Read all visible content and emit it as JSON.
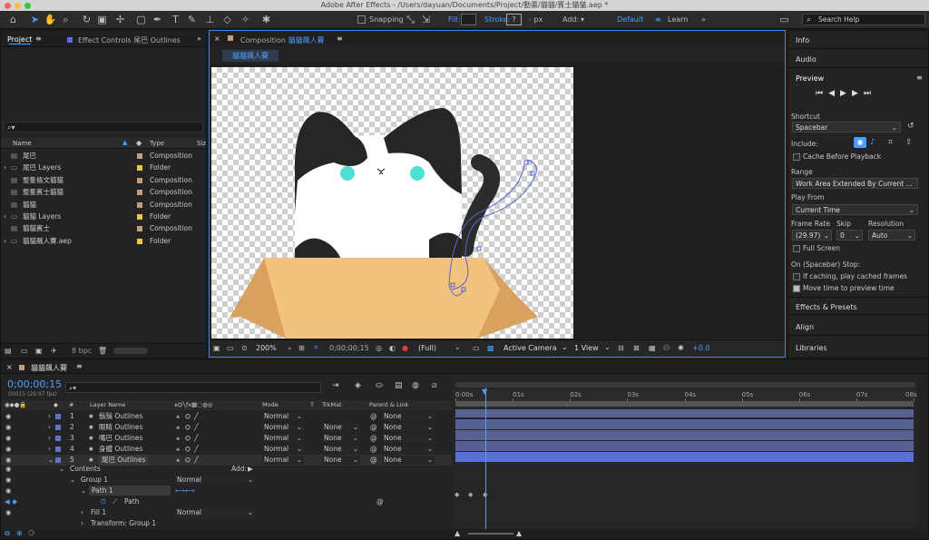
{
  "window_title": "Adobe After Effects - /Users/dayuan/Documents/Project/動畫/貓貓/賓士貓貓.aep *",
  "toolbar": {
    "snapping": "Snapping",
    "fill": "Fill:",
    "stroke": "Stroke:",
    "stroke_value": "?",
    "stroke_unit": "- px",
    "add": "Add:",
    "workspace_default": "Default",
    "workspace_learn": "Learn",
    "search_placeholder": "Search Help"
  },
  "project_panel": {
    "tab": "Project",
    "effect_tab": "Effect Controls 尾巴 Outlines",
    "columns": {
      "name": "Name",
      "type": "Type",
      "size": "Siz"
    },
    "items": [
      {
        "name": "尾巴",
        "type": "Composition",
        "color": "#c0a080"
      },
      {
        "name": "尾巴 Layers",
        "type": "Folder",
        "color": "#e8c84a"
      },
      {
        "name": "整隻條文貓貓",
        "type": "Composition",
        "color": "#c0a080"
      },
      {
        "name": "整隻賓士貓貓",
        "type": "Composition",
        "color": "#c0a080"
      },
      {
        "name": "貓貓",
        "type": "Composition",
        "color": "#c0a080"
      },
      {
        "name": "貓貓 Layers",
        "type": "Folder",
        "color": "#e8c84a"
      },
      {
        "name": "貓貓賓士",
        "type": "Composition",
        "color": "#c0a080"
      },
      {
        "name": "貓貓飆人賽.aep",
        "type": "Folder",
        "color": "#e8c84a"
      }
    ],
    "bpc": "8 bpc"
  },
  "composition": {
    "tab_prefix": "Composition",
    "tab_name": "貓貓飆人賽",
    "breadcrumb": "貓貓飆人賽",
    "zoom": "200%",
    "timecode": "0;00;00;15",
    "resolution": "(Full)",
    "camera": "Active Camera",
    "view": "1 View",
    "exposure": "+0.0"
  },
  "right_panel": {
    "info": "Info",
    "audio": "Audio",
    "preview": "Preview",
    "shortcut_label": "Shortcut",
    "shortcut_value": "Spacebar",
    "include_label": "Include:",
    "cache_before": "Cache Before Playback",
    "range_label": "Range",
    "range_value": "Work Area Extended By Current ...",
    "play_from_label": "Play From",
    "play_from_value": "Current Time",
    "frame_rate_label": "Frame Rate",
    "skip_label": "Skip",
    "resolution_label": "Resolution",
    "frame_rate_value": "(29.97)",
    "skip_value": "0",
    "resolution_value": "Auto",
    "full_screen": "Full Screen",
    "stop_label": "On (Spacebar) Stop:",
    "if_caching": "If caching, play cached frames",
    "move_time": "Move time to preview time",
    "effects_presets": "Effects & Presets",
    "align": "Align",
    "libraries": "Libraries"
  },
  "timeline": {
    "tab": "貓貓飆人賽",
    "timecode": "0;00;00;15",
    "fps": "00015 (29.97 fps)",
    "col_layer_name": "Layer Name",
    "col_mode": "Mode",
    "col_t": "T",
    "col_trkmat": "TrkMat",
    "col_parent": "Parent & Link",
    "ruler": [
      "0:00s",
      "01s",
      "02s",
      "03s",
      "04s",
      "05s",
      "06s",
      "07s",
      "08s"
    ],
    "layers": [
      {
        "num": "1",
        "name": "鬍鬚 Outlines",
        "mode": "Normal",
        "trkmat": "",
        "parent": "None"
      },
      {
        "num": "2",
        "name": "眼睛 Outlines",
        "mode": "Normal",
        "trkmat": "None",
        "parent": "None"
      },
      {
        "num": "3",
        "name": "嘴巴 Outlines",
        "mode": "Normal",
        "trkmat": "None",
        "parent": "None"
      },
      {
        "num": "4",
        "name": "身體 Outlines",
        "mode": "Normal",
        "trkmat": "None",
        "parent": "None"
      },
      {
        "num": "5",
        "name": "尾巴 Outlines",
        "mode": "Normal",
        "trkmat": "None",
        "parent": "None"
      }
    ],
    "contents": "Contents",
    "add": "Add:",
    "group1": "Group 1",
    "group1_mode": "Normal",
    "path1": "Path 1",
    "path": "Path",
    "fill1": "Fill 1",
    "fill1_mode": "Normal",
    "transform": "Transform: Group 1"
  }
}
